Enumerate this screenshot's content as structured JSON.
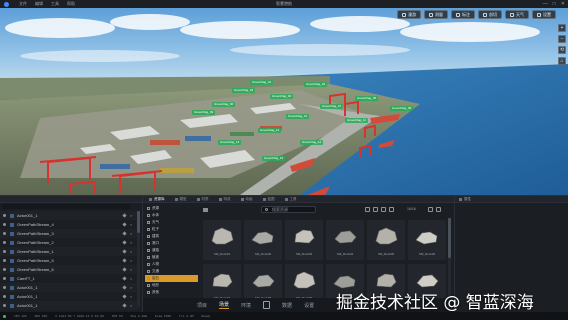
{
  "titlebar": {
    "menu": [
      "文件",
      "编辑",
      "工具",
      "帮助"
    ],
    "title": "智慧港航",
    "window_controls": [
      "—",
      "□",
      "✕"
    ]
  },
  "viewport": {
    "toolbar": [
      {
        "label": "漫游",
        "icon": "walk-icon"
      },
      {
        "label": "测量",
        "icon": "ruler-icon"
      },
      {
        "label": "标注",
        "icon": "tag-icon"
      },
      {
        "label": "剖切",
        "icon": "cut-icon"
      },
      {
        "label": "天气",
        "icon": "sun-icon"
      },
      {
        "label": "设置",
        "icon": "gear-icon"
      }
    ],
    "side_buttons": [
      "+",
      "−",
      "⟲",
      "⌂"
    ],
    "labels": [
      "GreenFlag_01",
      "GreenFlag_02",
      "GreenFlag_03",
      "GreenFlag_04",
      "GreenFlag_05",
      "GreenFlag_06",
      "GreenFlag_07",
      "GreenFlag_08",
      "GreenFlag_09",
      "GreenFlag_10",
      "GreenFlag_11",
      "GreenFlag_12",
      "GreenFlag_13",
      "GreenFlag_14",
      "GreenFlag_15"
    ]
  },
  "outliner": {
    "rows": [
      "Actor001_1",
      "GreenPathStream_4",
      "GreenPathStream_3",
      "GreenPathStream_2",
      "GreenPathStream_1",
      "GreenPathStream_5",
      "GreenPathStream_6",
      "CamFT_1",
      "Actor001_1",
      "Actor001_1",
      "Actor001_1"
    ]
  },
  "assets": {
    "tabs": [
      {
        "label": "资源库",
        "active": true
      },
      {
        "label": "模型",
        "active": false
      },
      {
        "label": "材质",
        "active": false
      },
      {
        "label": "特效",
        "active": false
      },
      {
        "label": "动画",
        "active": false
      },
      {
        "label": "蓝图",
        "active": false
      },
      {
        "label": "工具",
        "active": false
      }
    ],
    "categories": [
      {
        "label": "资源",
        "selected": false
      },
      {
        "label": "水体",
        "selected": false
      },
      {
        "label": "天气",
        "selected": false
      },
      {
        "label": "粒子",
        "selected": false
      },
      {
        "label": "建筑",
        "selected": false
      },
      {
        "label": "港口",
        "selected": false
      },
      {
        "label": "道路",
        "selected": false
      },
      {
        "label": "植被",
        "selected": false
      },
      {
        "label": "人物",
        "selected": false
      },
      {
        "label": "交通",
        "selected": false
      },
      {
        "label": "岩石",
        "selected": true
      },
      {
        "label": "地形",
        "selected": false
      },
      {
        "label": "其他",
        "selected": false
      }
    ],
    "search_placeholder": "搜索资源",
    "count": "16/16",
    "tiles": [
      "SM_Rock01",
      "SM_Rock02",
      "SM_Rock03",
      "SM_Rock04",
      "SM_Rock05",
      "SM_Rock06",
      "SM_Rock07",
      "SM_Rock08",
      "SM_Rock09",
      "SM_Rock10",
      "SM_Rock11",
      "SM_Rock12"
    ]
  },
  "properties": {
    "title": "属性"
  },
  "dock": {
    "items": [
      {
        "label": "项目",
        "active": false
      },
      {
        "label": "场景",
        "active": true
      },
      {
        "label": "环境",
        "active": false
      },
      {
        "label": "数据",
        "active": false
      },
      {
        "label": "设置",
        "active": false
      }
    ]
  },
  "watermark": "掘金技术社区 @ 智蓝深海",
  "statusbar": [
    "CPU 12%",
    "GPU 38%",
    "X 1024.56  Y 2048.12  Z 15.00",
    "FPS 60",
    "Mem 2.1GB",
    "Draw 1560",
    "Tri 2.4M",
    "Ready"
  ],
  "colors": {
    "accent": "#d89a2a",
    "label_green": "#28aa5a",
    "crane_red": "#d8322e",
    "sea": "#2d6ea8"
  }
}
